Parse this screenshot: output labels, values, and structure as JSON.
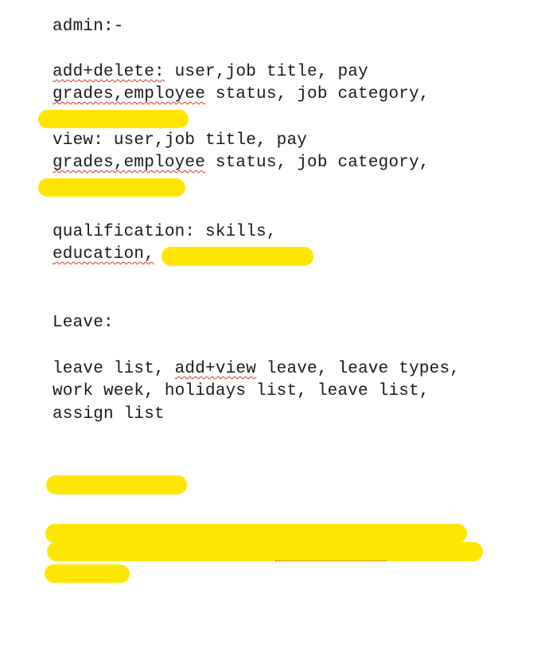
{
  "admin": {
    "heading": "admin:-",
    "add_delete_label": "add+delete:",
    "add_delete_line1_rest": " user,job title, pay",
    "add_delete_line2_a": "grades,employee",
    "add_delete_line2_b": " status, job category,",
    "view_label": "view:",
    "view_line1_rest": " user,job title, pay",
    "view_line2_a": "grades,employee",
    "view_line2_b": " status, job category,",
    "qualification_line1": "qualification: skills,",
    "qualification_line2": "education,"
  },
  "leave": {
    "heading": "Leave:",
    "line1_a": "leave list, ",
    "line1_b": "add+view",
    "line1_c": " leave, leave types,",
    "line2": "work week, holidays list, leave list,",
    "line3": "assign list"
  },
  "highlight_color": "#ffe600"
}
